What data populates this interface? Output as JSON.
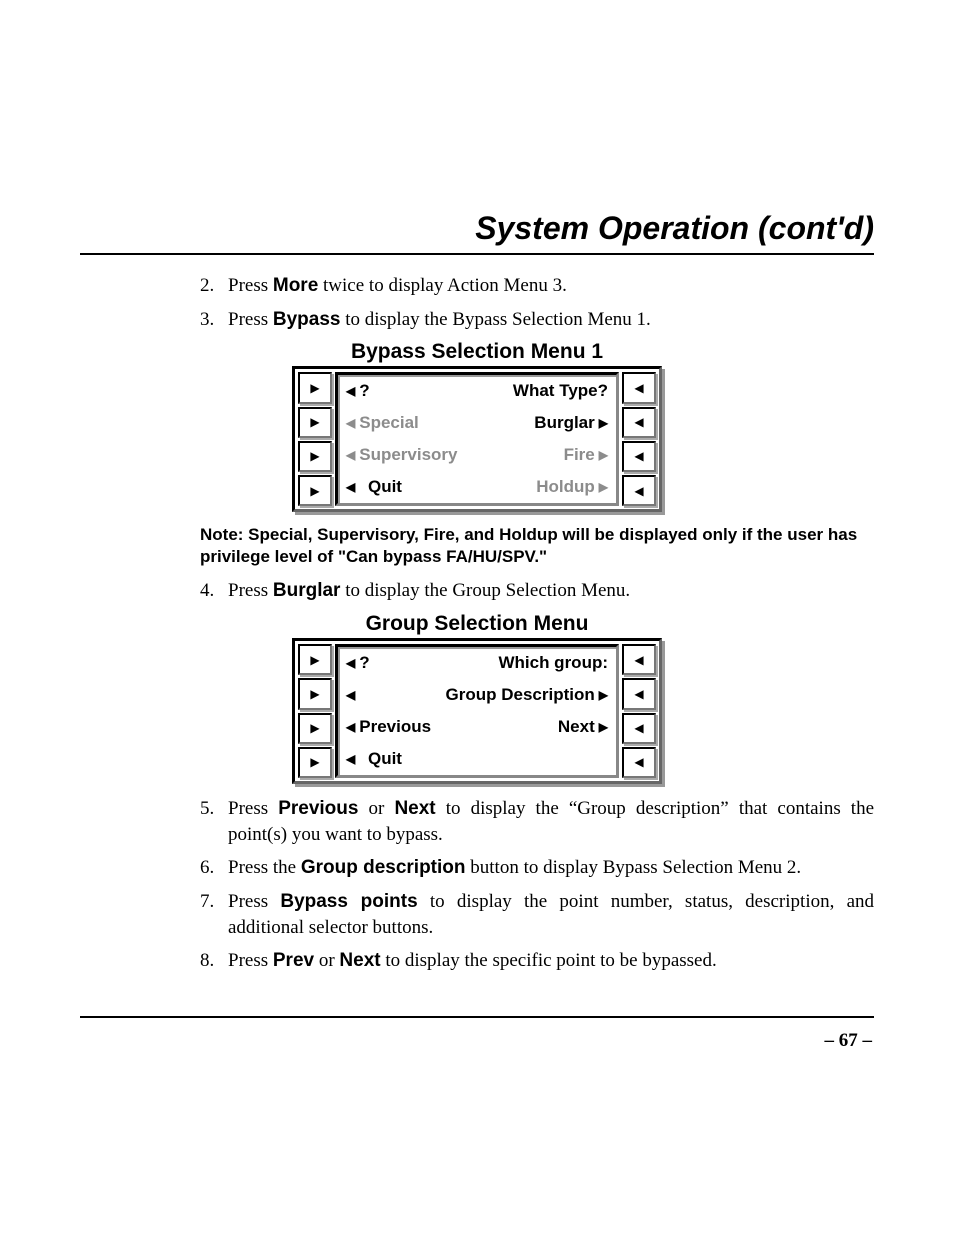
{
  "header": {
    "title": "System Operation (cont'd)"
  },
  "steps_top": [
    {
      "n": "2.",
      "pre": "Press ",
      "bold": "More",
      "post": " twice to display Action Menu 3."
    },
    {
      "n": "3.",
      "pre": "Press ",
      "bold": "Bypass",
      "post": " to display the Bypass Selection Menu 1."
    }
  ],
  "menu1": {
    "title": "Bypass Selection Menu 1",
    "row1": {
      "left_arrow": "◀",
      "left": "?",
      "center": "What Type?"
    },
    "row2": {
      "left": "Special",
      "left_gray": true,
      "right": "Burglar",
      "right_gray": false
    },
    "row3": {
      "left": "Supervisory",
      "left_gray": true,
      "right": "Fire",
      "right_gray": true
    },
    "row4": {
      "left": "Quit",
      "left_gray": false,
      "right": "Holdup",
      "right_gray": true
    }
  },
  "note": "Note: Special, Supervisory, Fire, and Holdup will be displayed only if the user has privilege level of \"Can bypass FA/HU/SPV.\"",
  "step4": {
    "n": "4.",
    "pre": "Press ",
    "bold": "Burglar",
    "post": " to display the Group Selection Menu."
  },
  "menu2": {
    "title": "Group Selection Menu",
    "row1": {
      "left_arrow": "◀",
      "left": "?",
      "center": "Which group:"
    },
    "row2": {
      "left_arrow_only": true,
      "right": "Group Description"
    },
    "row3": {
      "left": "Previous",
      "right": "Next"
    },
    "row4": {
      "left": "Quit"
    }
  },
  "steps_bottom": [
    {
      "n": "5.",
      "pre": "Press ",
      "bold": "Previous",
      "mid": " or ",
      "bold2": "Next",
      "post": " to display the “Group description” that contains the point(s) you want to bypass."
    },
    {
      "n": "6.",
      "pre": "Press the ",
      "bold": "Group description",
      "post": " button to display Bypass Selection Menu 2."
    },
    {
      "n": "7.",
      "pre": "Press ",
      "bold": "Bypass points",
      "post": " to display the point number, status, description, and additional selector buttons."
    },
    {
      "n": "8.",
      "pre": "Press ",
      "bold": "Prev",
      "mid": " or ",
      "bold2": "Next",
      "post": " to display the specific point to be bypassed."
    }
  ],
  "page_number": "– 67 –"
}
